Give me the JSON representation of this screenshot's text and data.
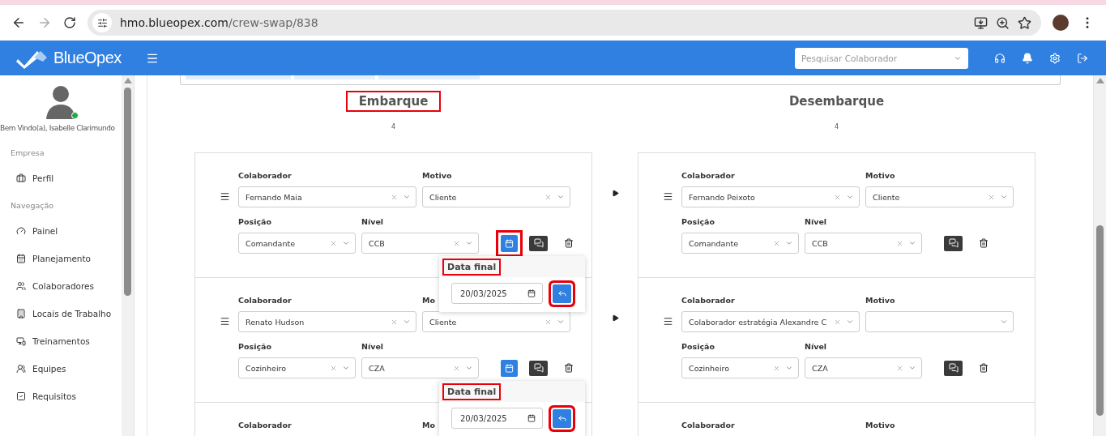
{
  "browser": {
    "url_host": "hmo.blueopex.com",
    "url_path": "/crew-swap/838"
  },
  "header": {
    "brand": "BlueOpex",
    "search_placeholder": "Pesquisar Colaborador"
  },
  "sidebar": {
    "greeting": "Bem Vindo(a), Isabelle Clarimundo",
    "online": true,
    "sections": [
      {
        "title": "Empresa",
        "items": [
          {
            "label": "Perfil"
          }
        ]
      },
      {
        "title": "Navegação",
        "items": [
          {
            "label": "Painel"
          },
          {
            "label": "Planejamento"
          },
          {
            "label": "Colaboradores"
          },
          {
            "label": "Locais de Trabalho"
          },
          {
            "label": "Treinamentos"
          },
          {
            "label": "Equipes"
          },
          {
            "label": "Requisitos"
          }
        ]
      }
    ]
  },
  "columns": [
    {
      "title": "Embarque",
      "count": "4",
      "highlighted": true,
      "rows": [
        {
          "calendar_button": {
            "highlighted": true
          },
          "fields": [
            {
              "label": "Colaborador",
              "value": "Fernando Maia"
            },
            {
              "label": "Motivo",
              "value": "Cliente"
            },
            {
              "label": "Posição",
              "value": "Comandante"
            },
            {
              "label": "Nível",
              "value": "CCB"
            }
          ],
          "popover": {
            "title": "Data final",
            "date": "20/03/2025",
            "highlighted": true
          }
        },
        {
          "calendar_button": {
            "highlighted": false
          },
          "fields": [
            {
              "label": "Colaborador",
              "value": "Renato Hudson"
            },
            {
              "label": "Mo",
              "value": "Cliente"
            },
            {
              "label": "Posição",
              "value": "Cozinheiro"
            },
            {
              "label": "Nível",
              "value": "CZA"
            }
          ],
          "popover": {
            "title": "Data final",
            "date": "20/03/2025",
            "highlighted": true
          }
        },
        {
          "fields": [
            {
              "label": "Colaborador"
            },
            {
              "label": "Mo"
            }
          ]
        }
      ]
    },
    {
      "title": "Desembarque",
      "count": "4",
      "highlighted": false,
      "rows": [
        {
          "fields": [
            {
              "label": "Colaborador",
              "value": "Fernando Peixoto"
            },
            {
              "label": "Motivo",
              "value": "Cliente"
            },
            {
              "label": "Posição",
              "value": "Comandante"
            },
            {
              "label": "Nível",
              "value": "CCB"
            }
          ]
        },
        {
          "fields": [
            {
              "label": "Colaborador",
              "value": "Colaborador estratégia Alexandre C"
            },
            {
              "label": "Motivo"
            },
            {
              "label": "Posição",
              "value": "Cozinheiro"
            },
            {
              "label": "Nível",
              "value": "CZA"
            }
          ]
        },
        {
          "fields": [
            {
              "label": "Colaborador"
            },
            {
              "label": "Motivo"
            }
          ]
        }
      ]
    }
  ]
}
